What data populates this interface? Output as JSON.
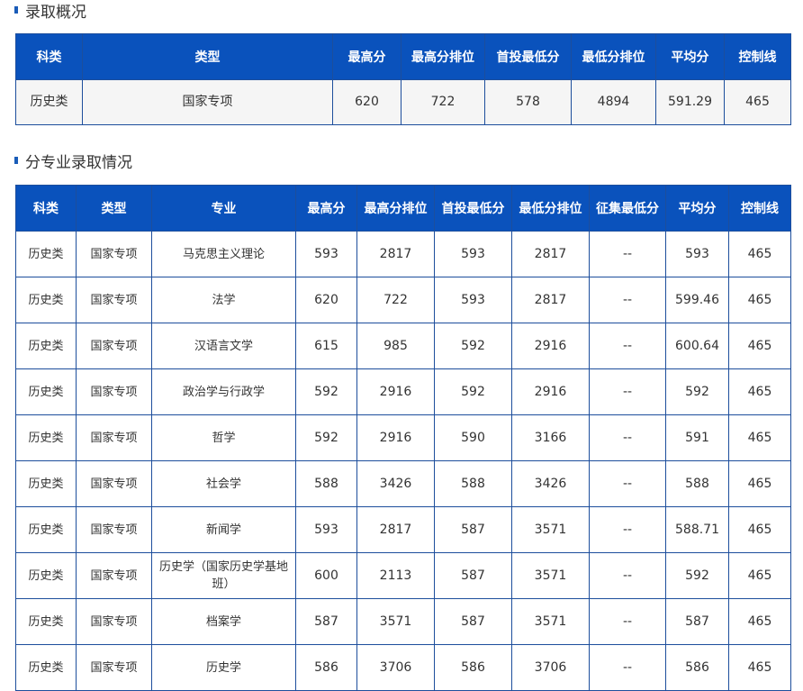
{
  "sections": {
    "summary_title": "录取概况",
    "major_title": "分专业录取情况"
  },
  "summary_table": {
    "headers": [
      "科类",
      "类型",
      "最高分",
      "最高分排位",
      "首投最低分",
      "最低分排位",
      "平均分",
      "控制线"
    ],
    "row": [
      "历史类",
      "国家专项",
      "620",
      "722",
      "578",
      "4894",
      "591.29",
      "465"
    ]
  },
  "major_table": {
    "headers": [
      "科类",
      "类型",
      "专业",
      "最高分",
      "最高分排位",
      "首投最低分",
      "最低分排位",
      "征集最低分",
      "平均分",
      "控制线"
    ],
    "rows": [
      [
        "历史类",
        "国家专项",
        "马克思主义理论",
        "593",
        "2817",
        "593",
        "2817",
        "--",
        "593",
        "465"
      ],
      [
        "历史类",
        "国家专项",
        "法学",
        "620",
        "722",
        "593",
        "2817",
        "--",
        "599.46",
        "465"
      ],
      [
        "历史类",
        "国家专项",
        "汉语言文学",
        "615",
        "985",
        "592",
        "2916",
        "--",
        "600.64",
        "465"
      ],
      [
        "历史类",
        "国家专项",
        "政治学与行政学",
        "592",
        "2916",
        "592",
        "2916",
        "--",
        "592",
        "465"
      ],
      [
        "历史类",
        "国家专项",
        "哲学",
        "592",
        "2916",
        "590",
        "3166",
        "--",
        "591",
        "465"
      ],
      [
        "历史类",
        "国家专项",
        "社会学",
        "588",
        "3426",
        "588",
        "3426",
        "--",
        "588",
        "465"
      ],
      [
        "历史类",
        "国家专项",
        "新闻学",
        "593",
        "2817",
        "587",
        "3571",
        "--",
        "588.71",
        "465"
      ],
      [
        "历史类",
        "国家专项",
        "历史学（国家历史学基地班）",
        "600",
        "2113",
        "587",
        "3571",
        "--",
        "592",
        "465"
      ],
      [
        "历史类",
        "国家专项",
        "档案学",
        "587",
        "3571",
        "587",
        "3571",
        "--",
        "587",
        "465"
      ],
      [
        "历史类",
        "国家专项",
        "历史学",
        "586",
        "3706",
        "586",
        "3706",
        "--",
        "586",
        "465"
      ]
    ]
  },
  "colors": {
    "header_bg": "#0a52bc",
    "border": "#1d4e9c",
    "bullet": "#1a5cb8",
    "summary_row_bg": "#f5f5f5"
  }
}
